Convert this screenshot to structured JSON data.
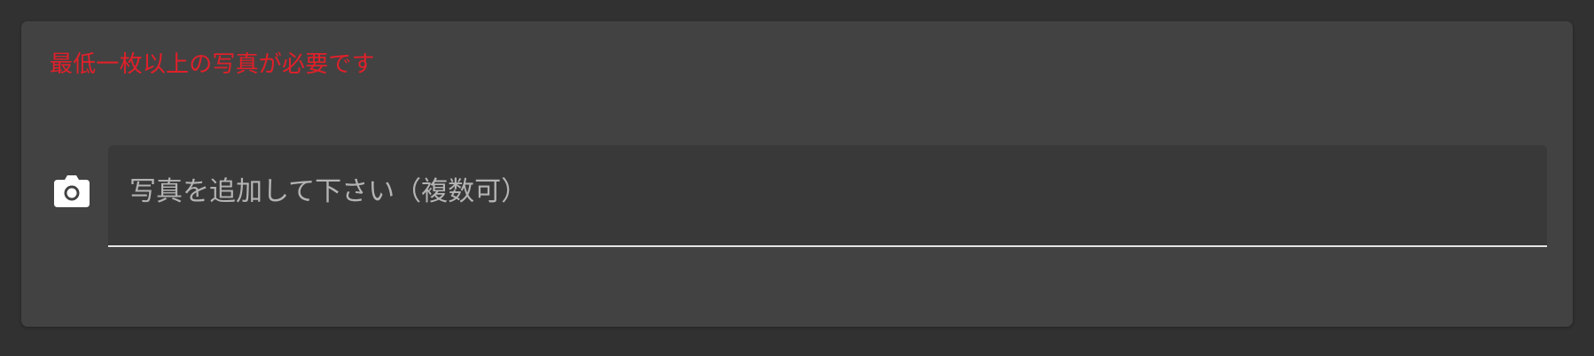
{
  "form": {
    "error_message": "最低一枚以上の写真が必要です",
    "photo_field": {
      "label": "写真を追加して下さい（複数可）",
      "icon": "camera-icon"
    }
  },
  "colors": {
    "background": "#313131",
    "card": "#424242",
    "field": "#393939",
    "error": "#e0202a",
    "underline": "#e6e6e6"
  }
}
